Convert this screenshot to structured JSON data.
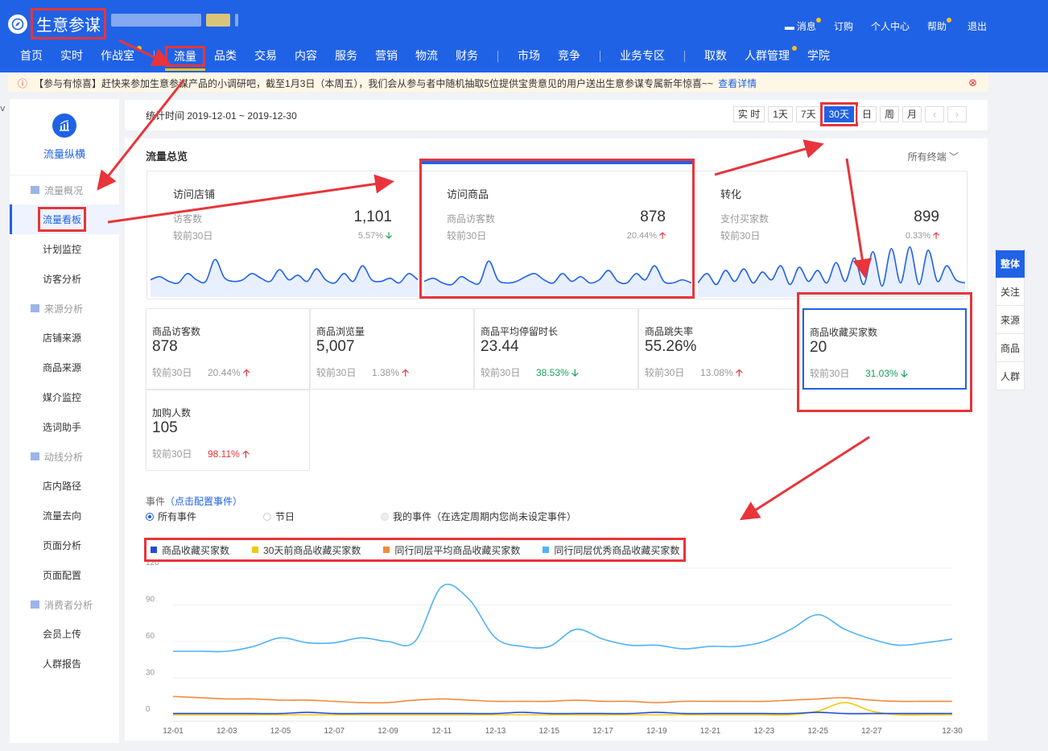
{
  "app": {
    "title": "生意参谋"
  },
  "top_links": [
    "消息",
    "订购",
    "个人中心",
    "帮助",
    "退出"
  ],
  "nav": [
    {
      "label": "首页"
    },
    {
      "label": "实时"
    },
    {
      "label": "作战室"
    },
    {
      "label": "流量"
    },
    {
      "label": "品类"
    },
    {
      "label": "交易"
    },
    {
      "label": "内容"
    },
    {
      "label": "服务"
    },
    {
      "label": "营销"
    },
    {
      "label": "物流"
    },
    {
      "label": "财务"
    },
    {
      "label": "市场"
    },
    {
      "label": "竞争"
    },
    {
      "label": "业务专区"
    },
    {
      "label": "取数"
    },
    {
      "label": "人群管理"
    },
    {
      "label": "学院"
    }
  ],
  "notice": {
    "text": "【参与有惊喜】赶快来参加生意参谋产品的小调研吧，截至1月3日（本周五），我们会从参与者中随机抽取5位提供宝贵意见的用户送出生意参谋专属新年惊喜~~",
    "link": "查看详情"
  },
  "sidebar": {
    "title": "流量纵横",
    "groups": [
      {
        "label": "流量概况",
        "items": [
          "流量看板",
          "计划监控",
          "访客分析"
        ]
      },
      {
        "label": "来源分析",
        "items": [
          "店铺来源",
          "商品来源",
          "媒介监控",
          "选词助手"
        ]
      },
      {
        "label": "动线分析",
        "items": [
          "店内路径",
          "流量去向",
          "页面分析",
          "页面配置"
        ]
      },
      {
        "label": "消费者分析",
        "items": [
          "会员上传",
          "人群报告"
        ]
      }
    ]
  },
  "datebar": {
    "label": "统计时间 2019-12-01 ~ 2019-12-30",
    "buttons": [
      "实 时",
      "1天",
      "7天",
      "30天",
      "日",
      "周",
      "月"
    ],
    "active": "30天"
  },
  "panel": {
    "title": "流量总览",
    "terminal": "所有终端"
  },
  "overview": [
    {
      "name": "访问店铺",
      "label": "访客数",
      "value": "1,101",
      "compare": "较前30日",
      "pct": "5.57%",
      "dir": "down",
      "spark": [
        22,
        26,
        20,
        18,
        30,
        22,
        20,
        48,
        25,
        20,
        22,
        30,
        24,
        20,
        35,
        22,
        28,
        20,
        36,
        22,
        18,
        30,
        20,
        40,
        22,
        20,
        24,
        18,
        30,
        22
      ]
    },
    {
      "name": "访问商品",
      "label": "商品访客数",
      "value": "878",
      "compare": "较前30日",
      "pct": "20.44%",
      "dir": "up",
      "spark": [
        20,
        24,
        18,
        16,
        26,
        20,
        18,
        46,
        22,
        18,
        20,
        26,
        30,
        22,
        18,
        30,
        20,
        26,
        18,
        22,
        34,
        20,
        18,
        30,
        22,
        40,
        20,
        18,
        22,
        18
      ]
    },
    {
      "name": "转化",
      "label": "支付买家数",
      "value": "899",
      "compare": "较前30日",
      "pct": "0.33%",
      "dir": "up",
      "spark": [
        18,
        30,
        16,
        34,
        20,
        36,
        18,
        32,
        22,
        40,
        16,
        38,
        20,
        34,
        18,
        44,
        20,
        50,
        16,
        58,
        14,
        62,
        18,
        64,
        16,
        60,
        20,
        40,
        22,
        18
      ]
    }
  ],
  "metrics": [
    {
      "name": "商品访客数",
      "value": "878",
      "compare": "较前30日",
      "pct": "20.44%",
      "dir": "up"
    },
    {
      "name": "商品浏览量",
      "value": "5,007",
      "compare": "较前30日",
      "pct": "1.38%",
      "dir": "up"
    },
    {
      "name": "商品平均停留时长",
      "value": "23.44",
      "compare": "较前30日",
      "pct": "38.53%",
      "dir": "down"
    },
    {
      "name": "商品跳失率",
      "value": "55.26%",
      "compare": "较前30日",
      "pct": "13.08%",
      "dir": "up"
    },
    {
      "name": "商品收藏买家数",
      "value": "20",
      "compare": "较前30日",
      "pct": "31.03%",
      "dir": "down"
    },
    {
      "name": "加购人数",
      "value": "105",
      "compare": "较前30日",
      "pct": "98.11%",
      "dir": "up"
    }
  ],
  "events": {
    "label": "事件",
    "link": "（点击配置事件）",
    "radios": [
      "所有事件",
      "节日",
      "我的事件（在选定周期内您尚未设定事件）"
    ]
  },
  "right_tabs": [
    "整体",
    "关注",
    "来源",
    "商品",
    "人群"
  ],
  "colors": {
    "brand": "#2062e6",
    "annotation": "#e8343a",
    "up": "#e8343a",
    "down": "#18a058"
  },
  "chart_data": {
    "type": "line",
    "x": [
      "12-01",
      "12-02",
      "12-03",
      "12-04",
      "12-05",
      "12-06",
      "12-07",
      "12-08",
      "12-09",
      "12-10",
      "12-11",
      "12-12",
      "12-13",
      "12-14",
      "12-15",
      "12-16",
      "12-17",
      "12-18",
      "12-19",
      "12-20",
      "12-21",
      "12-22",
      "12-23",
      "12-24",
      "12-25",
      "12-26",
      "12-27",
      "12-28",
      "12-29",
      "12-30"
    ],
    "x_tick_labels": [
      "12-01",
      "12-03",
      "12-05",
      "12-07",
      "12-09",
      "12-11",
      "12-13",
      "12-15",
      "12-17",
      "12-19",
      "12-21",
      "12-23",
      "12-25",
      "12-27",
      "12-30"
    ],
    "y_ticks": [
      "0",
      "30",
      "60",
      "90",
      "120"
    ],
    "ylim": [
      0,
      120
    ],
    "series": [
      {
        "name": "商品收藏买家数",
        "color": "#1f4fd6",
        "values": [
          1,
          1,
          1,
          1,
          1,
          2,
          1,
          1,
          1,
          1,
          1,
          1,
          1,
          2,
          1,
          1,
          1,
          1,
          2,
          1,
          1,
          1,
          1,
          1,
          2,
          1,
          1,
          1,
          1,
          1
        ]
      },
      {
        "name": "30天前商品收藏买家数",
        "color": "#f2c811",
        "values": [
          0,
          0,
          0,
          0,
          0,
          0,
          0,
          0,
          0,
          0,
          0,
          0,
          0,
          0,
          0,
          0,
          0,
          0,
          0,
          0,
          0,
          0,
          0,
          0,
          3,
          10,
          3,
          0,
          0,
          0
        ]
      },
      {
        "name": "同行同层平均商品收藏买家数",
        "color": "#f58a3c",
        "values": [
          15,
          14,
          13,
          13,
          12,
          12,
          11,
          10,
          10,
          12,
          13,
          12,
          11,
          11,
          11,
          12,
          11,
          11,
          10,
          11,
          11,
          11,
          11,
          12,
          13,
          14,
          12,
          11,
          11,
          11
        ]
      },
      {
        "name": "同行同层优秀商品收藏买家数",
        "color": "#4fb3f6",
        "values": [
          52,
          52,
          52,
          56,
          63,
          59,
          59,
          63,
          60,
          60,
          105,
          95,
          63,
          56,
          56,
          70,
          62,
          57,
          57,
          54,
          56,
          56,
          60,
          70,
          82,
          70,
          62,
          57,
          59,
          62
        ]
      }
    ]
  }
}
